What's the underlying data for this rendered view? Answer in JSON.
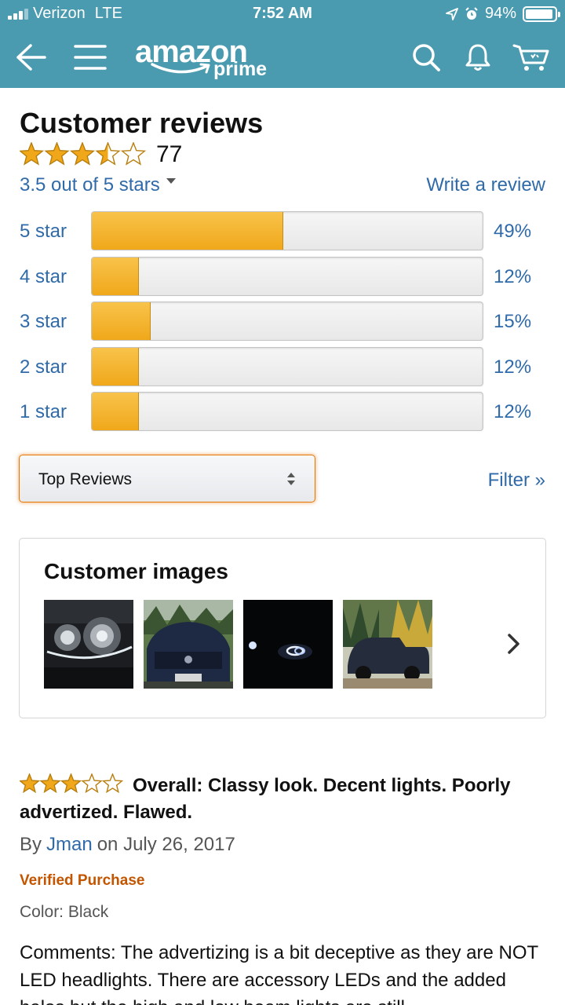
{
  "status_bar": {
    "carrier": "Verizon",
    "network": "LTE",
    "time": "7:52 AM",
    "battery": "94%",
    "battery_level": 0.94
  },
  "nav": {
    "icons": [
      "back-arrow-icon",
      "menu-icon",
      "search-icon",
      "bell-icon",
      "cart-icon"
    ],
    "logo_word": "amazon",
    "logo_sub": "prime",
    "brand_color": "#4a9bb0"
  },
  "reviews": {
    "title": "Customer reviews",
    "star_rating": 3.5,
    "count": "77",
    "rating_text": "3.5 out of 5 stars",
    "write_review": "Write a review",
    "histogram": [
      {
        "label": "5 star",
        "percent_text": "49%",
        "percent": 49
      },
      {
        "label": "4 star",
        "percent_text": "12%",
        "percent": 12
      },
      {
        "label": "3 star",
        "percent_text": "15%",
        "percent": 15
      },
      {
        "label": "2 star",
        "percent_text": "12%",
        "percent": 12
      },
      {
        "label": "1 star",
        "percent_text": "12%",
        "percent": 12
      }
    ],
    "sort_value": "Top Reviews",
    "filter": "Filter »"
  },
  "customer_images": {
    "title": "Customer images",
    "thumbnails": [
      "headlight-closeup",
      "truck-front",
      "headlights-night",
      "truck-side"
    ]
  },
  "review": {
    "star_rating": 3,
    "title": "Overall: Classy look. Decent lights. Poorly advertized. Flawed.",
    "by_prefix": "By",
    "author": "Jman",
    "date": "on July 26, 2017",
    "verified": "Verified Purchase",
    "color": "Color: Black",
    "body": "Comments: The advertizing is a bit deceptive as they are NOT LED headlights. There are accessory LEDs and the added halos but the high and low beam lights are still"
  },
  "colors": {
    "link": "#2f6aa9",
    "star": "#f0a81a",
    "verified": "#c45500",
    "select_border": "#e77600"
  }
}
